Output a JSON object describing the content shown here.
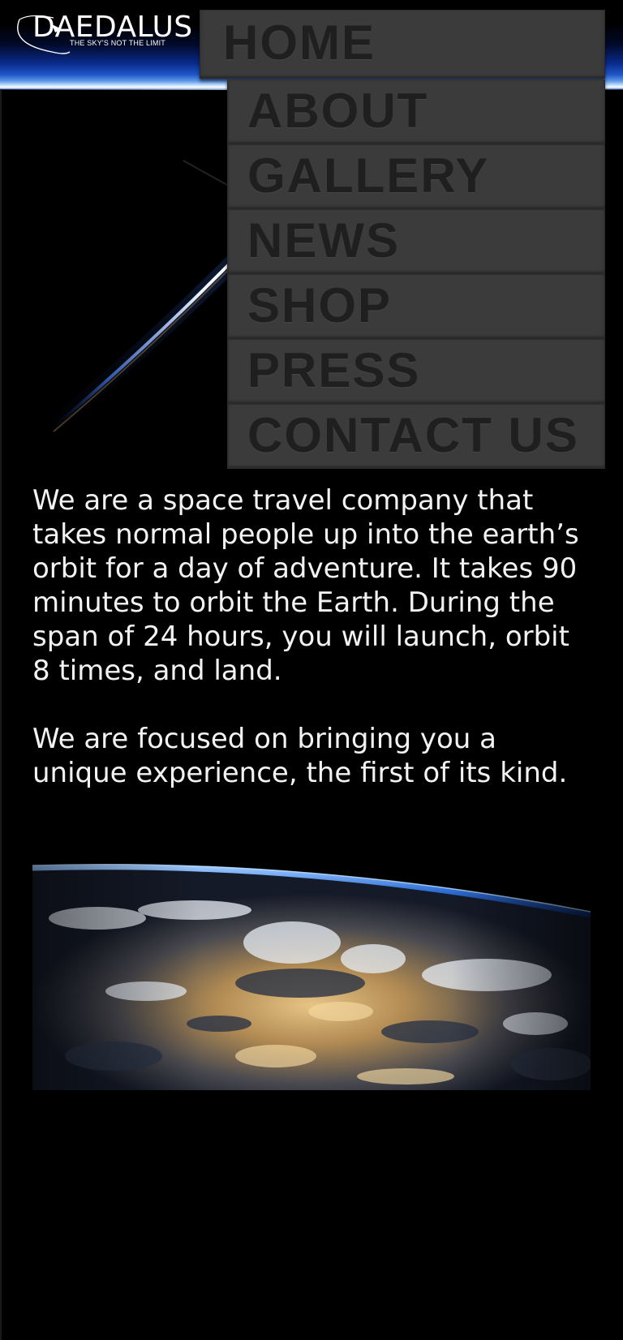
{
  "brand": {
    "name": "DAEDALUS",
    "tagline": "THE SKY'S NOT THE LIMIT"
  },
  "menu": {
    "toggle_icon": "hamburger-menu-icon",
    "items": [
      {
        "label": "HOME"
      },
      {
        "label": "ABOUT"
      },
      {
        "label": "GALLERY"
      },
      {
        "label": "NEWS"
      },
      {
        "label": "SHOP"
      },
      {
        "label": "PRESS"
      },
      {
        "label": "CONTACT US"
      }
    ]
  },
  "content": {
    "paragraph_1": "We are a space travel company that takes normal people up into the earth’s orbit for a day of adventure. It takes 90 minutes to orbit the Earth. During the span of 24 hours, you will launch, orbit 8 times, and land.",
    "paragraph_2": "We are focused on bringing you a unique experience, the first of its kind."
  },
  "colors": {
    "background": "#000000",
    "menu_item_bg": "#3b3b3b",
    "menu_text": "#1f1f1f",
    "body_text": "#f2f2f2",
    "horizon_blue": "#1f56c8"
  }
}
